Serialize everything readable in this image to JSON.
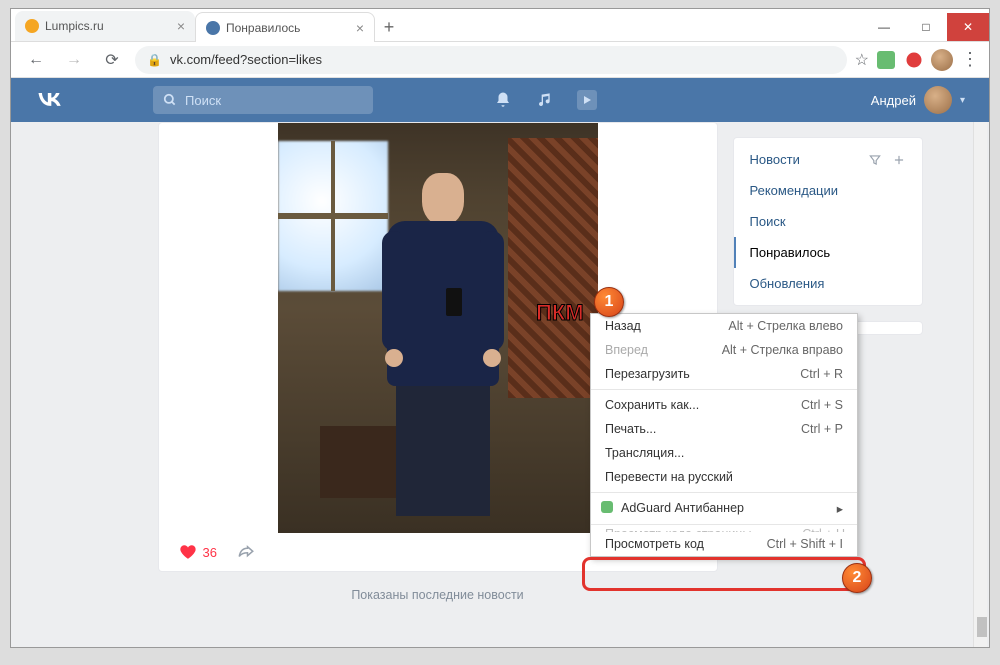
{
  "window": {
    "minimize": "—",
    "maximize": "□",
    "close": "✕"
  },
  "tabs": [
    {
      "title": "Lumpics.ru",
      "favicon_color": "#f5a623",
      "active": false
    },
    {
      "title": "Понравилось",
      "favicon_color": "#4a76a8",
      "active": true
    }
  ],
  "addressbar": {
    "back": "←",
    "forward": "→",
    "reload": "⟳",
    "url": "vk.com/feed?section=likes",
    "star": "☆",
    "menu": "⋮"
  },
  "vk_header": {
    "search_placeholder": "Поиск",
    "user_name": "Андрей"
  },
  "sidebar": {
    "items": [
      {
        "label": "Новости",
        "heading": true
      },
      {
        "label": "Рекомендации"
      },
      {
        "label": "Поиск"
      },
      {
        "label": "Понравилось",
        "active": true
      },
      {
        "label": "Обновления"
      }
    ]
  },
  "post": {
    "like_count": "36"
  },
  "footer": {
    "message": "Показаны последние новости"
  },
  "context_menu": {
    "back": {
      "label": "Назад",
      "shortcut": "Alt + Стрелка влево"
    },
    "forward": {
      "label": "Вперед",
      "shortcut": "Alt + Стрелка вправо"
    },
    "reload": {
      "label": "Перезагрузить",
      "shortcut": "Ctrl + R"
    },
    "save_as": {
      "label": "Сохранить как...",
      "shortcut": "Ctrl + S"
    },
    "print": {
      "label": "Печать...",
      "shortcut": "Ctrl + P"
    },
    "cast": {
      "label": "Трансляция..."
    },
    "translate": {
      "label": "Перевести на русский"
    },
    "adguard": {
      "label": "AdGuard Антибаннер"
    },
    "view_source": {
      "label": "Просмотр кода страницы",
      "shortcut": "Ctrl + U"
    },
    "inspect": {
      "label": "Просмотреть код",
      "shortcut": "Ctrl + Shift + I"
    }
  },
  "annotations": {
    "pkm": "ПКМ",
    "callout1": "1",
    "callout2": "2"
  }
}
